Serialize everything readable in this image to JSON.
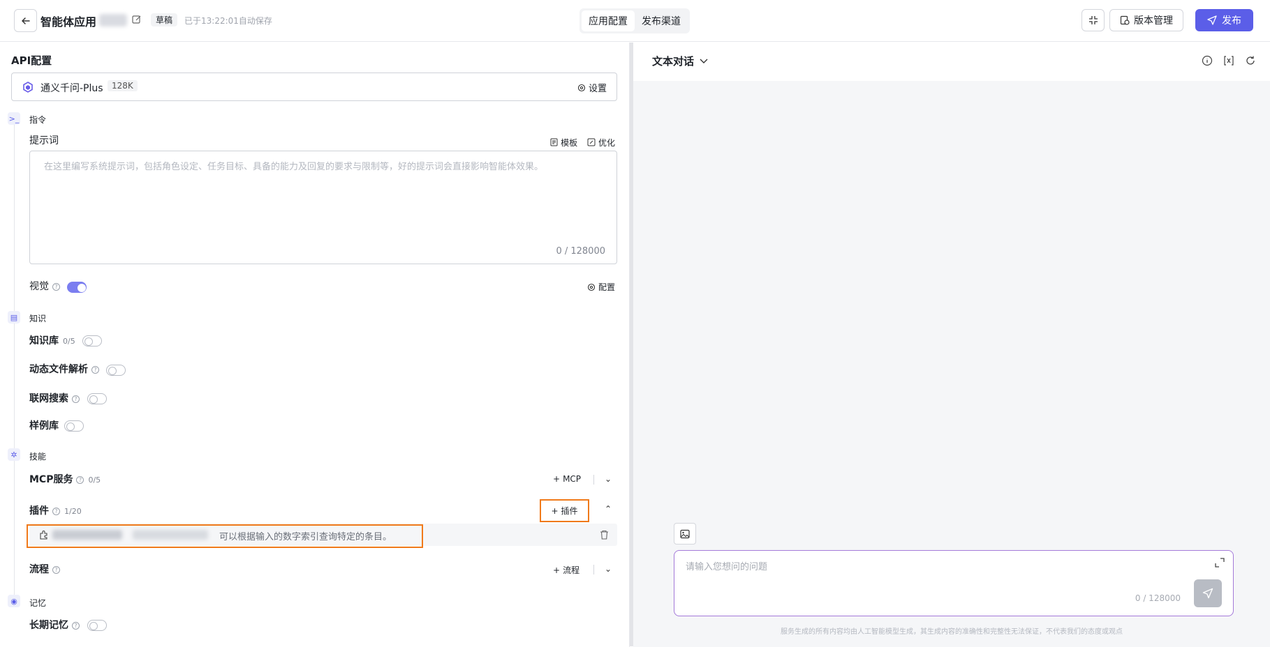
{
  "header": {
    "app_title": "智能体应用",
    "draft_label": "草稿",
    "autosave_text": "已于13:22:01自动保存",
    "tabs": [
      {
        "label": "应用配置",
        "active": true
      },
      {
        "label": "发布渠道",
        "active": false
      }
    ],
    "version_label": "版本管理",
    "publish_label": "发布",
    "accent_color": "#5b5ee8"
  },
  "left": {
    "section_title": "API配置",
    "model": {
      "name": "通义千问-Plus",
      "context": "128K",
      "settings_label": "设置"
    },
    "instruction_group": "指令",
    "prompt": {
      "label": "提示词",
      "template_label": "模板",
      "optimize_label": "优化",
      "placeholder": "在这里编写系统提示词，包括角色设定、任务目标、具备的能力及回复的要求与限制等，好的提示词会直接影响智能体效果。",
      "count": "0 / 128000"
    },
    "vision": {
      "label": "视觉",
      "enabled": true,
      "config_label": "配置"
    },
    "knowledge_group": "知识",
    "knowledge_base": {
      "label": "知识库",
      "count": "0/5",
      "enabled": false
    },
    "file_parse": {
      "label": "动态文件解析",
      "enabled": false
    },
    "web_search": {
      "label": "联网搜索",
      "enabled": false
    },
    "examples": {
      "label": "样例库",
      "enabled": false
    },
    "skills_group": "技能",
    "mcp": {
      "label": "MCP服务",
      "count": "0/5",
      "add_label": "MCP"
    },
    "plugins": {
      "label": "插件",
      "count": "1/20",
      "add_label": "插件",
      "item_description": "可以根据输入的数字索引查询特定的条目。"
    },
    "flow": {
      "label": "流程",
      "add_label": "流程"
    },
    "memory_group": "记忆",
    "long_memory": {
      "label": "长期记忆",
      "enabled": false
    },
    "highlight_color": "#f07a1a"
  },
  "right": {
    "mode_label": "文本对话",
    "input_placeholder": "请输入您想问的问题",
    "input_count": "0 / 128000",
    "disclaimer": "服务生成的所有内容均由人工智能模型生成，其生成内容的准确性和完整性无法保证，不代表我们的态度或观点"
  }
}
